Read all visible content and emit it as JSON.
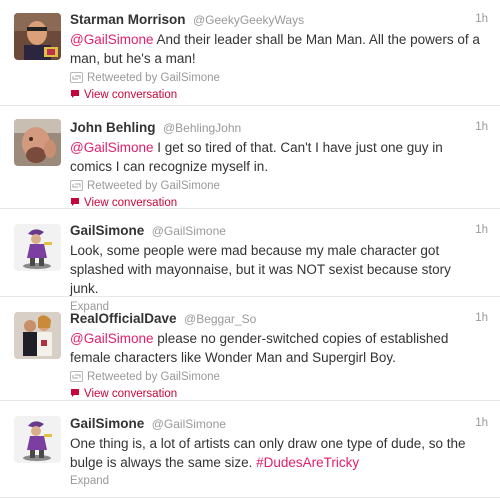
{
  "colors": {
    "link": "#e0206d",
    "action": "#c5063b",
    "muted": "#999999",
    "text": "#333333"
  },
  "tweets": [
    {
      "fullname": "Starman Morrison",
      "username": "@GeekyGeekyWays",
      "time": "1h",
      "mention": "@GailSimone",
      "text": " And their leader shall be Man Man.  All the powers of a man, but he's a man!",
      "retweeted_by": "Retweeted by GailSimone",
      "action": "View conversation",
      "avatar_icon": "avatar-photo-icon"
    },
    {
      "fullname": "John Behling",
      "username": "@BehlingJohn",
      "time": "1h",
      "mention": "@GailSimone",
      "text": " I get so tired of that. Can't I have just one guy in comics I can recognize myself in.",
      "retweeted_by": "Retweeted by GailSimone",
      "action": "View conversation",
      "avatar_icon": "avatar-photo-icon"
    },
    {
      "fullname": "GailSimone",
      "username": "@GailSimone",
      "time": "1h",
      "text": "Look, some people were mad because my male character got splashed with mayonnaise, but it was NOT sexist because story junk.",
      "expand": "Expand",
      "avatar_icon": "avatar-figurine-icon"
    },
    {
      "fullname": "RealOfficialDave",
      "username": "@Beggar_So",
      "time": "1h",
      "mention": "@GailSimone",
      "text": " please no gender-switched copies of established female characters like Wonder Man and Supergirl Boy.",
      "retweeted_by": "Retweeted by GailSimone",
      "action": "View conversation",
      "avatar_icon": "avatar-photo-icon"
    },
    {
      "fullname": "GailSimone",
      "username": "@GailSimone",
      "time": "1h",
      "text": "One thing is, a lot of artists can only draw one type of dude, so the bulge is always the same size. ",
      "hashtag": "#DudesAreTricky",
      "expand": "Expand",
      "avatar_icon": "avatar-figurine-icon"
    }
  ]
}
